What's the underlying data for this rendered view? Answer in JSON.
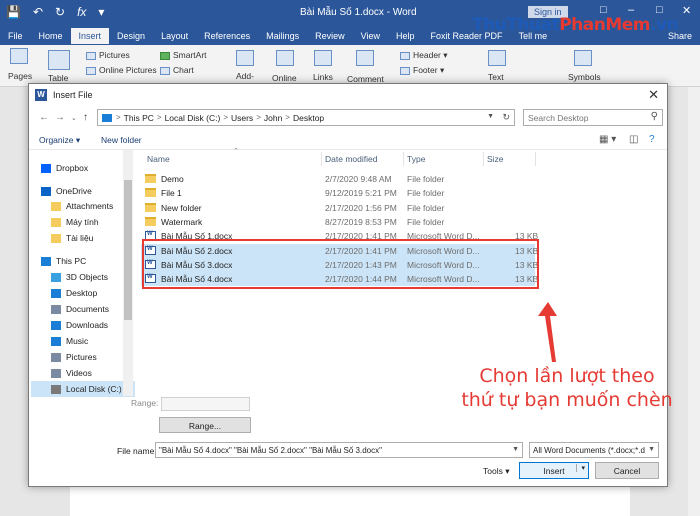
{
  "word": {
    "title": "Bài Mẫu Số 1.docx  -  Word",
    "signin": "Sign in",
    "share": "Share",
    "tabs": [
      "File",
      "Home",
      "Insert",
      "Design",
      "Layout",
      "References",
      "Mailings",
      "Review",
      "View",
      "Help",
      "Foxit Reader PDF",
      "Tell me"
    ],
    "active_tab": "Insert",
    "ribbon": {
      "pages": "Pages",
      "table": "Table",
      "pictures": "Pictures",
      "online_pictures": "Online Pictures",
      "smartart": "SmartArt",
      "chart": "Chart",
      "addins": "Add-",
      "online": "Online",
      "links": "Links",
      "comment": "Comment",
      "header": "Header",
      "footer": "Footer",
      "text": "Text",
      "symbols": "Symbols"
    }
  },
  "watermark": {
    "part1": "ThuThuat",
    "part2": "PhanMem",
    "part3": ".vn"
  },
  "dialog": {
    "title": "Insert File",
    "breadcrumb": [
      "This PC",
      "Local Disk (C:)",
      "Users",
      "John",
      "Desktop"
    ],
    "search_placeholder": "Search Desktop",
    "toolbar": {
      "organize": "Organize",
      "new_folder": "New folder"
    },
    "nav": [
      {
        "label": "Dropbox",
        "icon": "dropbox-icon",
        "color": "#0061fe"
      },
      {
        "label": "OneDrive",
        "icon": "onedrive-icon",
        "color": "#0a64c8"
      },
      {
        "label": "Attachments",
        "icon": "folder-icon",
        "color": "#f5cd5f"
      },
      {
        "label": "Máy tính",
        "icon": "folder-icon",
        "color": "#f5cd5f"
      },
      {
        "label": "Tài liệu",
        "icon": "folder-icon",
        "color": "#f5cd5f"
      },
      {
        "label": "This PC",
        "icon": "pc-icon",
        "color": "#1a7ed6"
      },
      {
        "label": "3D Objects",
        "icon": "cube-icon",
        "color": "#3aa0e0"
      },
      {
        "label": "Desktop",
        "icon": "desktop-icon",
        "color": "#1a7ed6"
      },
      {
        "label": "Documents",
        "icon": "documents-icon",
        "color": "#7a8aa0"
      },
      {
        "label": "Downloads",
        "icon": "download-icon",
        "color": "#1a7ed6"
      },
      {
        "label": "Music",
        "icon": "music-icon",
        "color": "#1a7ed6"
      },
      {
        "label": "Pictures",
        "icon": "pictures-icon",
        "color": "#7a8aa0"
      },
      {
        "label": "Videos",
        "icon": "videos-icon",
        "color": "#7a8aa0"
      },
      {
        "label": "Local Disk (C:)",
        "icon": "disk-icon",
        "color": "#7a7a7a"
      }
    ],
    "columns": {
      "name": "Name",
      "date": "Date modified",
      "type": "Type",
      "size": "Size"
    },
    "files": [
      {
        "name": "Demo",
        "date": "2/7/2020 9:48 AM",
        "type": "File folder",
        "size": "",
        "kind": "folder",
        "selected": false
      },
      {
        "name": "File 1",
        "date": "9/12/2019 5:21 PM",
        "type": "File folder",
        "size": "",
        "kind": "folder",
        "selected": false
      },
      {
        "name": "New folder",
        "date": "2/17/2020 1:56 PM",
        "type": "File folder",
        "size": "",
        "kind": "folder",
        "selected": false
      },
      {
        "name": "Watermark",
        "date": "8/27/2019 8:53 PM",
        "type": "File folder",
        "size": "",
        "kind": "folder",
        "selected": false
      },
      {
        "name": "Bài Mẫu Số 1.docx",
        "date": "2/17/2020 1:41 PM",
        "type": "Microsoft Word D...",
        "size": "13 KB",
        "kind": "doc",
        "selected": false
      },
      {
        "name": "Bài Mẫu Số 2.docx",
        "date": "2/17/2020 1:41 PM",
        "type": "Microsoft Word D...",
        "size": "13 KB",
        "kind": "doc",
        "selected": true
      },
      {
        "name": "Bài Mẫu Số 3.docx",
        "date": "2/17/2020 1:43 PM",
        "type": "Microsoft Word D...",
        "size": "13 KB",
        "kind": "doc",
        "selected": true
      },
      {
        "name": "Bài Mẫu Số 4.docx",
        "date": "2/17/2020 1:44 PM",
        "type": "Microsoft Word D...",
        "size": "13 KB",
        "kind": "doc",
        "selected": true
      }
    ],
    "range_label": "Range:",
    "range_button": "Range...",
    "filename_label": "File name:",
    "filename_value": "\"Bài Mẫu Số 4.docx\" \"Bài Mẫu Số 2.docx\" \"Bài Mẫu Số 3.docx\"",
    "filetype_value": "All Word Documents (*.docx;*.d",
    "tools": "Tools",
    "insert": "Insert",
    "cancel": "Cancel"
  },
  "annotation": {
    "line1": "Chọn lần lượt theo",
    "line2": "thứ tự bạn muốn chèn",
    "color": "#e53b34"
  }
}
